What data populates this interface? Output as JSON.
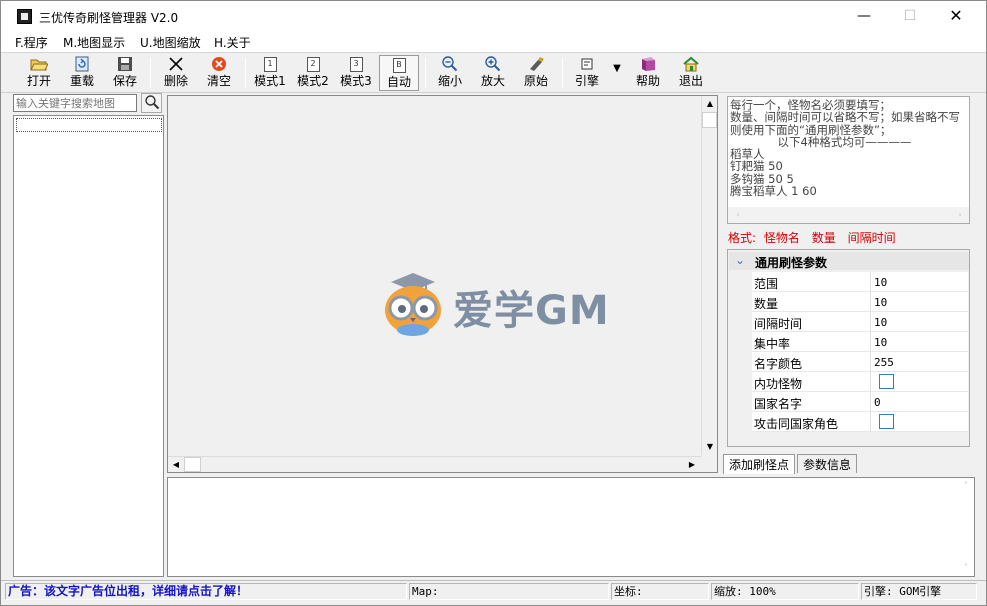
{
  "window": {
    "title": "三优传奇刷怪管理器 V2.0",
    "min": "—",
    "max": "☐",
    "close": "✕"
  },
  "menu": [
    "F.程序",
    "M.地图显示",
    "U.地图缩放",
    "H.关于"
  ],
  "toolbar": {
    "open": "打开",
    "reload": "重载",
    "save": "保存",
    "delete": "删除",
    "clear": "清空",
    "mode1": "模式1",
    "mode2": "模式2",
    "mode3": "模式3",
    "auto": "自动",
    "zoom_out": "缩小",
    "zoom_in": "放大",
    "original": "原始",
    "engine": "引擎",
    "help": "帮助",
    "exit": "退出",
    "mode1_icon": "1",
    "mode2_icon": "2",
    "mode3_icon": "3",
    "auto_icon": "B"
  },
  "search": {
    "placeholder": "输入关键字搜索地图"
  },
  "watermark": {
    "text": "爱学GM"
  },
  "note": {
    "text": "每行一个，怪物名必须要填写；\n数量、间隔时间可以省略不写；如果省略不写则使用下面的“通用刷怪参数”；\n             以下4种格式均可————\n稻草人\n钉耙猫 50\n多钩猫 50 5\n腾宝稻草人 1 60"
  },
  "format": {
    "label": "格式:",
    "f1": "怪物名",
    "f2": "数量",
    "f3": "间隔时间"
  },
  "params": {
    "header": "通用刷怪参数",
    "rows": [
      {
        "key": "范围",
        "value": "10"
      },
      {
        "key": "数量",
        "value": "10"
      },
      {
        "key": "间隔时间",
        "value": "10"
      },
      {
        "key": "集中率",
        "value": "10"
      },
      {
        "key": "名字颜色",
        "value": "255"
      },
      {
        "key": "内功怪物",
        "value": ""
      },
      {
        "key": "国家名字",
        "value": "0"
      },
      {
        "key": "攻击同国家角色",
        "value": ""
      }
    ]
  },
  "tabs": {
    "add": "添加刷怪点",
    "info": "参数信息"
  },
  "status": {
    "ad": "广告：该文字广告位出租，详细请点击了解！",
    "map": "Map:",
    "coord": "坐标:",
    "zoom": "缩放: 100%",
    "engine": "引擎: GOM引擎"
  }
}
